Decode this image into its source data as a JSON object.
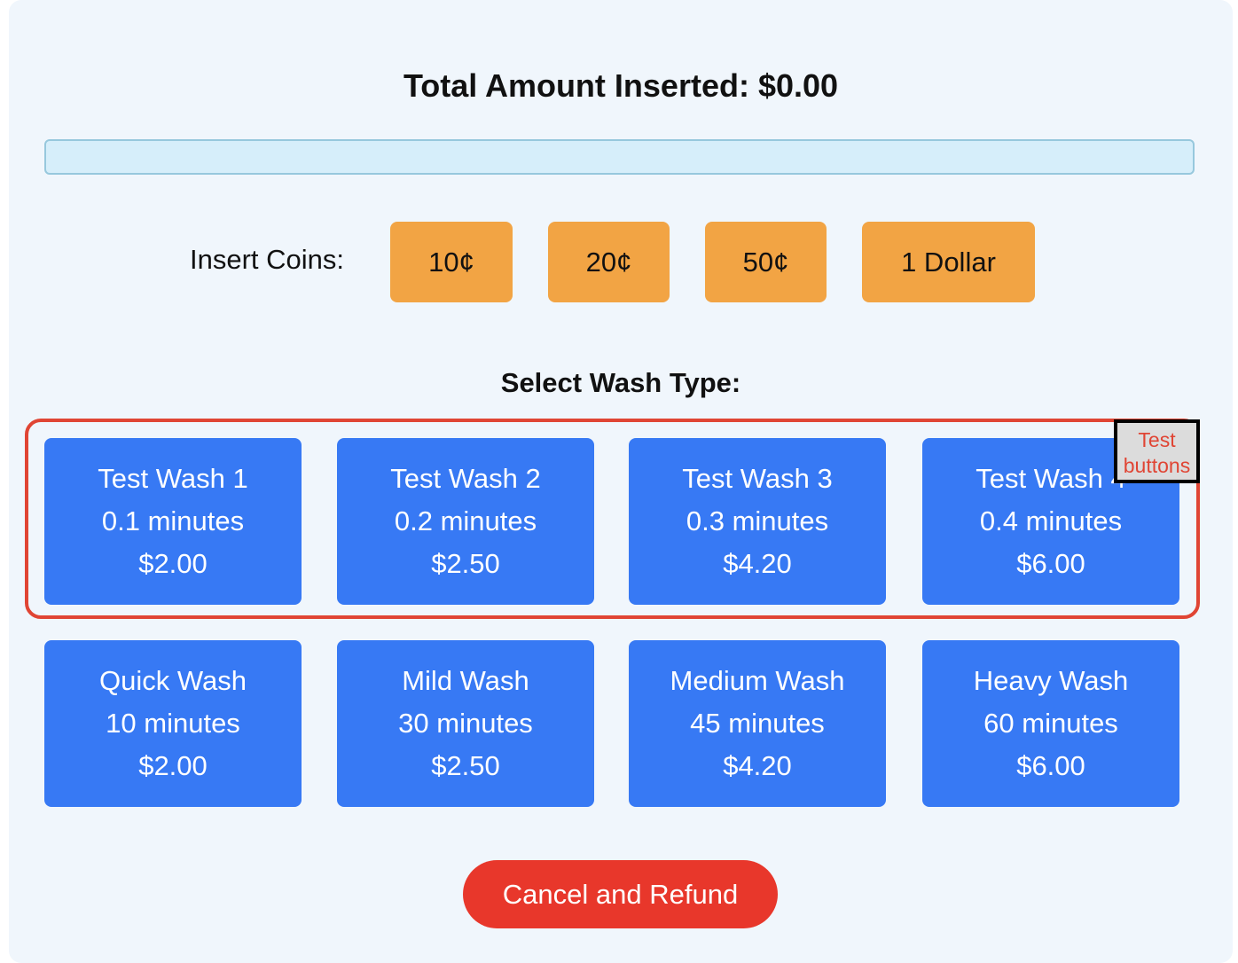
{
  "header": {
    "total_text": "Total Amount Inserted: $0.00",
    "progress": 0
  },
  "coins": {
    "label": "Insert Coins:",
    "buttons": [
      "10¢",
      "20¢",
      "50¢",
      "1 Dollar"
    ]
  },
  "wash": {
    "label": "Select Wash Type:",
    "test_group_label": "Test buttons",
    "test_options": [
      {
        "name": "Test Wash 1",
        "duration": "0.1 minutes",
        "price": "$2.00"
      },
      {
        "name": "Test Wash 2",
        "duration": "0.2 minutes",
        "price": "$2.50"
      },
      {
        "name": "Test Wash 3",
        "duration": "0.3 minutes",
        "price": "$4.20"
      },
      {
        "name": "Test Wash 4",
        "duration": "0.4 minutes",
        "price": "$6.00"
      }
    ],
    "options": [
      {
        "name": "Quick Wash",
        "duration": "10 minutes",
        "price": "$2.00"
      },
      {
        "name": "Mild Wash",
        "duration": "30 minutes",
        "price": "$2.50"
      },
      {
        "name": "Medium Wash",
        "duration": "45 minutes",
        "price": "$4.20"
      },
      {
        "name": "Heavy Wash",
        "duration": "60 minutes",
        "price": "$6.00"
      }
    ]
  },
  "actions": {
    "cancel_label": "Cancel and Refund"
  },
  "colors": {
    "coin_button": "#f2a444",
    "wash_button": "#3779f4",
    "cancel_button": "#e8372b",
    "test_frame": "#e04534",
    "progress_track": "#d6eefa"
  }
}
